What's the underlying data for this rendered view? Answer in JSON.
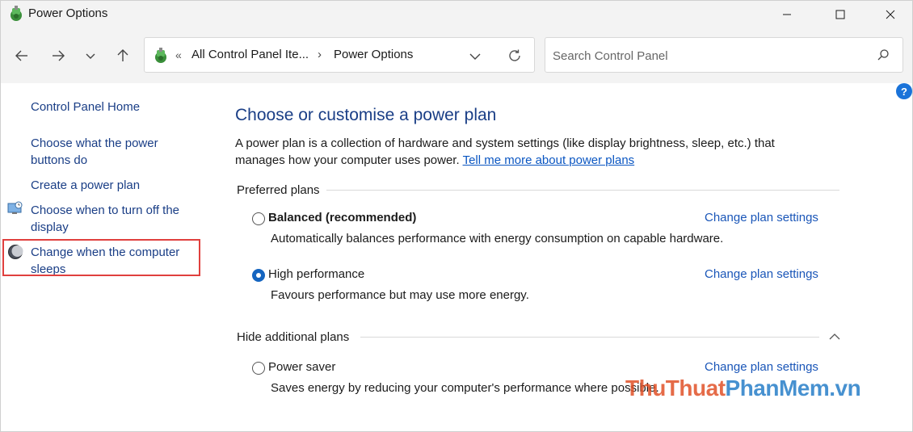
{
  "window": {
    "title": "Power Options"
  },
  "address": {
    "overflow": "«",
    "crumb1": "All Control Panel Ite...",
    "separator": "›",
    "crumb2": "Power Options"
  },
  "search": {
    "placeholder": "Search Control Panel"
  },
  "help": {
    "label": "?"
  },
  "sidebar": {
    "items": [
      {
        "label": "Control Panel Home"
      },
      {
        "label": "Choose what the power buttons do"
      },
      {
        "label": "Create a power plan"
      },
      {
        "label": "Choose when to turn off the display"
      },
      {
        "label": "Change when the computer sleeps"
      }
    ]
  },
  "main": {
    "title": "Choose or customise a power plan",
    "description": "A power plan is a collection of hardware and system settings (like display brightness, sleep, etc.) that manages how your computer uses power.",
    "learn_more": "Tell me more about power plans",
    "preferred_heading": "Preferred plans",
    "additional_heading": "Hide additional plans",
    "plans": [
      {
        "name": "Balanced (recommended)",
        "description": "Automatically balances performance with energy consumption on capable hardware.",
        "link": "Change plan settings",
        "selected": false
      },
      {
        "name": "High performance",
        "description": "Favours performance but may use more energy.",
        "link": "Change plan settings",
        "selected": true
      },
      {
        "name": "Power saver",
        "description": "Saves energy by reducing your computer's performance where possible.",
        "link": "Change plan settings",
        "selected": false
      }
    ]
  },
  "watermark": {
    "part1": "ThuThuat",
    "part2": "PhanMem",
    "part3": ".vn"
  },
  "colors": {
    "link": "#1a3e86",
    "accent": "#1565c0",
    "highlight": "#e0403e"
  }
}
